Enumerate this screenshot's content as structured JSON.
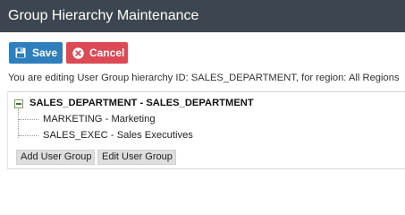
{
  "header": {
    "title": "Group Hierarchy Maintenance"
  },
  "toolbar": {
    "save_label": "Save",
    "cancel_label": "Cancel"
  },
  "info_text": "You are editing User Group hierarchy ID: SALES_DEPARTMENT, for region: All Regions",
  "tree": {
    "root": "SALES_DEPARTMENT - SALES_DEPARTMENT",
    "children": [
      "MARKETING - Marketing",
      "SALES_EXEC - Sales Executives"
    ]
  },
  "actions": {
    "add_label": "Add User Group",
    "edit_label": "Edit User Group"
  },
  "colors": {
    "header_bg": "#3d4650",
    "save_bg": "#2f7fbf",
    "cancel_bg": "#dc4b55"
  }
}
